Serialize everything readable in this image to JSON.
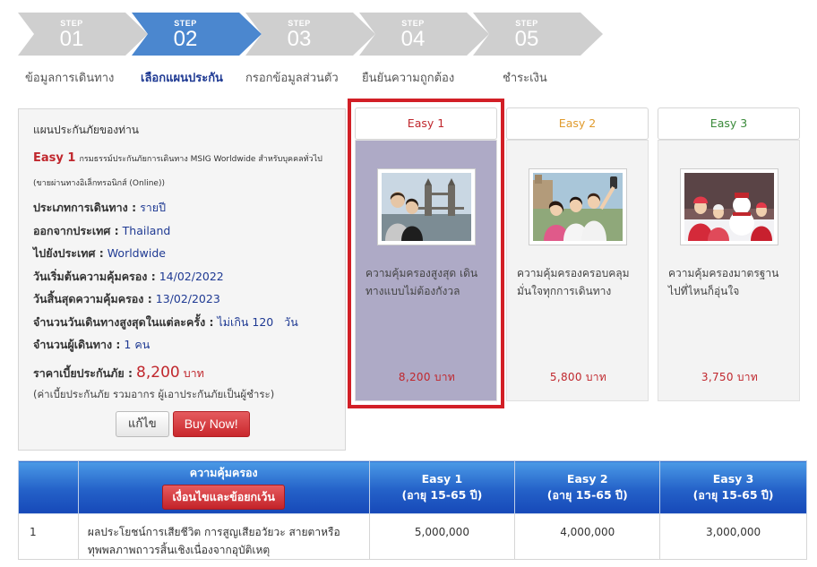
{
  "steps": [
    {
      "word": "STEP",
      "num": "01",
      "label": "ข้อมูลการเดินทาง",
      "active": false
    },
    {
      "word": "STEP",
      "num": "02",
      "label": "เลือกแผนประกัน",
      "active": true
    },
    {
      "word": "STEP",
      "num": "03",
      "label": "กรอกข้อมูลส่วนตัว",
      "active": false
    },
    {
      "word": "STEP",
      "num": "04",
      "label": "ยืนยันความถูกต้อง",
      "active": false
    },
    {
      "word": "STEP",
      "num": "05",
      "label": "ชำระเงิน",
      "active": false
    }
  ],
  "summary": {
    "title": "แผนประกันภัยของท่าน",
    "plan_name": "Easy 1",
    "plan_desc": "กรมธรรม์ประกันภัยการเดินทาง MSIG Worldwide สำหรับบุคคลทั่วไป (ขายผ่านทางอิเล็กทรอนิกส์ (Online))",
    "rows": [
      {
        "label": "ประเภทการเดินทาง :",
        "value": "รายปี"
      },
      {
        "label": "ออกจากประเทศ :",
        "value": "Thailand"
      },
      {
        "label": "ไปยังประเทศ :",
        "value": "Worldwide"
      },
      {
        "label": "วันเริ่มต้นความคุ้มครอง :",
        "value": "14/02/2022"
      },
      {
        "label": "วันสิ้นสุดความคุ้มครอง :",
        "value": "13/02/2023"
      },
      {
        "label": "จำนวนวันเดินทางสูงสุดในแต่ละครั้ง :",
        "value": "ไม่เกิน 120   วัน"
      },
      {
        "label": "จำนวนผู้เดินทาง :",
        "value": "1 คน"
      }
    ],
    "price_label": "ราคาเบี้ยประกันภัย :",
    "price_value": "8,200",
    "price_unit": "บาท",
    "note": "(ค่าเบี้ยประกันภัย รวมอากร ผู้เอาประกันภัยเป็นผู้ชำระ)",
    "edit_label": "แก้ไข",
    "buy_label": "Buy Now!"
  },
  "plans": [
    {
      "name": "Easy 1",
      "color": "#c0272d",
      "desc": "ความคุ้มครองสูงสุด เดินทางแบบไม่ต้องกังวล",
      "price": "8,200 บาท",
      "selected": true
    },
    {
      "name": "Easy 2",
      "color": "#e09b2d",
      "desc": "ความคุ้มครองครอบคลุม มั่นใจทุกการเดินทาง",
      "price": "5,800 บาท",
      "selected": false
    },
    {
      "name": "Easy 3",
      "color": "#3a8a3a",
      "desc": "ความคุ้มครองมาตรฐาน ไปที่ไหนก็อุ่นใจ",
      "price": "3,750 บาท",
      "selected": false
    }
  ],
  "table": {
    "col_coverage": "ความคุ้มครอง",
    "cond_button": "เงื่อนไขและข้อยกเว้น",
    "columns": [
      {
        "name": "Easy 1",
        "age": "(อายุ 15-65 ปี)"
      },
      {
        "name": "Easy 2",
        "age": "(อายุ 15-65 ปี)"
      },
      {
        "name": "Easy 3",
        "age": "(อายุ 15-65 ปี)"
      }
    ],
    "rows": [
      {
        "no": "1",
        "desc": "ผลประโยชน์การเสียชีวิต การสูญเสียอวัยวะ สายตาหรือทุพพลภาพถาวรสิ้นเชิงเนื่องจากอุบัติเหตุ",
        "v1": "5,000,000",
        "v2": "4,000,000",
        "v3": "3,000,000"
      }
    ]
  }
}
